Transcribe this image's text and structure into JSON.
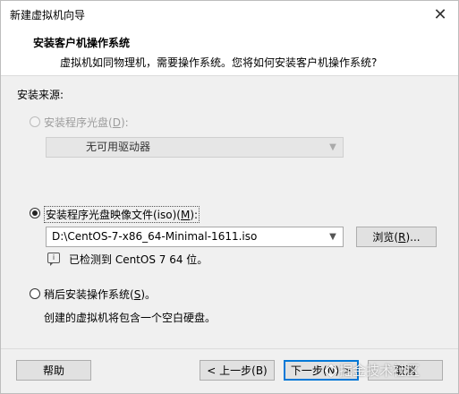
{
  "window": {
    "title": "新建虚拟机向导"
  },
  "header": {
    "title": "安装客户机操作系统",
    "subtitle": "虚拟机如同物理机，需要操作系统。您将如何安装客户机操作系统?"
  },
  "source": {
    "label": "安装来源:",
    "disc": {
      "label_prefix": "安装程序光盘(",
      "label_key": "D",
      "label_suffix": "):",
      "selected": false,
      "enabled": false,
      "combo_value": "无可用驱动器"
    },
    "iso": {
      "label_prefix": "安装程序光盘映像文件(iso)(",
      "label_key": "M",
      "label_suffix": "):",
      "selected": true,
      "path": "D:\\CentOS-7-x86_64-Minimal-1611.iso",
      "browse_prefix": "浏览(",
      "browse_key": "R",
      "browse_suffix": ")...",
      "detected_text": "已检测到 CentOS 7 64 位。"
    },
    "later": {
      "label_prefix": "稍后安装操作系统(",
      "label_key": "S",
      "label_suffix": ")。",
      "selected": false,
      "description": "创建的虚拟机将包含一个空白硬盘。"
    }
  },
  "footer": {
    "help": "帮助",
    "back": "< 上一步(B)",
    "next": "下一步(N) >",
    "cancel": "取消"
  },
  "watermark": "掘金技术社区"
}
